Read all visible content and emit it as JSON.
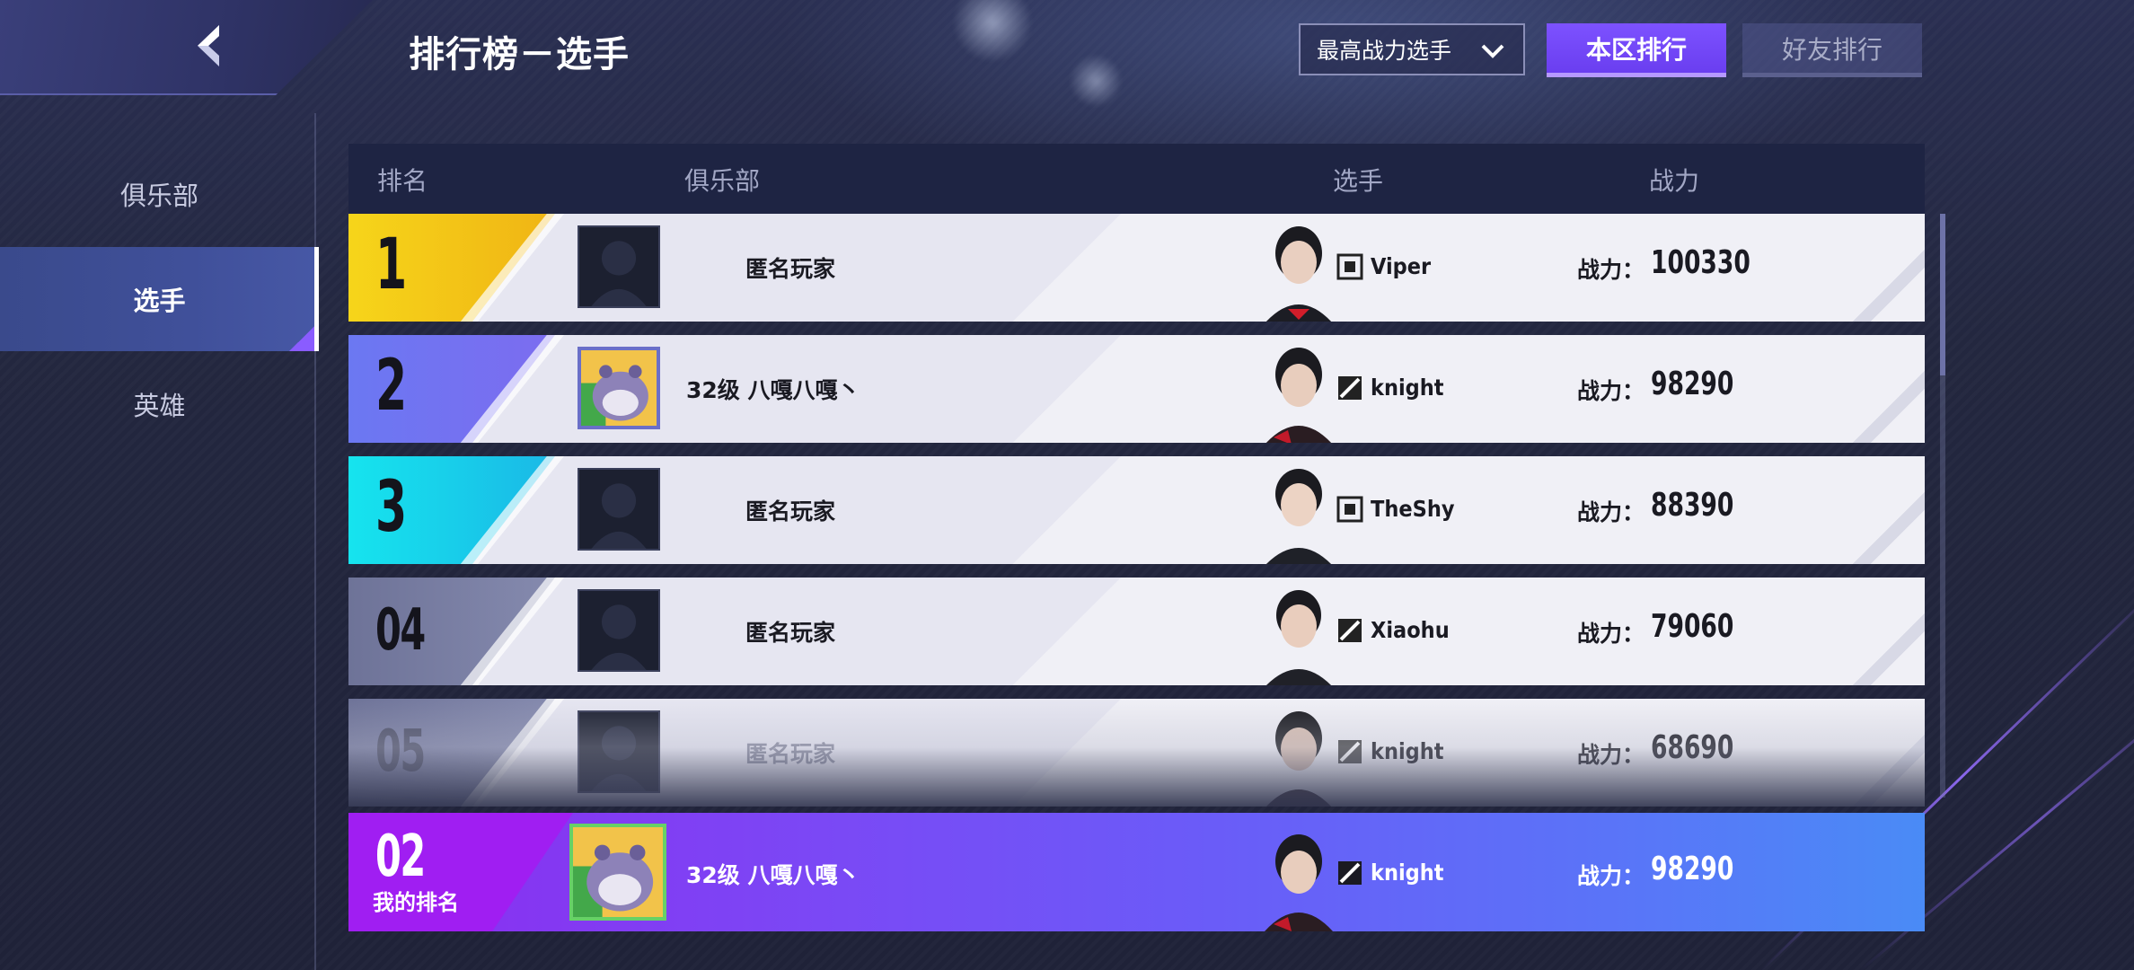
{
  "header": {
    "title": "排行榜－选手",
    "dropdown_label": "最高战力选手",
    "tab_local": "本区排行",
    "tab_friends": "好友排行"
  },
  "sidebar": {
    "items": [
      {
        "label": "俱乐部"
      },
      {
        "label": "选手"
      },
      {
        "label": "英雄"
      }
    ]
  },
  "table": {
    "headers": {
      "rank": "排名",
      "club": "俱乐部",
      "player": "选手",
      "power": "战力"
    },
    "rows": [
      {
        "rank": "1",
        "club": "匿名玩家",
        "player": "Viper",
        "power_label": "战力：",
        "power": "100330",
        "rank_color": "#f6c81a"
      },
      {
        "rank": "2",
        "club": "32级  八嘎八嘎丶",
        "player": "knight",
        "power_label": "战力：",
        "power": "98290",
        "rank_color": "#6f7ef2"
      },
      {
        "rank": "3",
        "club": "匿名玩家",
        "player": "TheShy",
        "power_label": "战力：",
        "power": "88390",
        "rank_color": "#19d6e8"
      },
      {
        "rank": "04",
        "club": "匿名玩家",
        "player": "Xiaohu",
        "power_label": "战力：",
        "power": "79060",
        "rank_color": "#7a7fa6"
      },
      {
        "rank": "05",
        "club": "匿名玩家",
        "player": "knight",
        "power_label": "战力：",
        "power": "68690",
        "rank_color": "#7a7fa6"
      }
    ]
  },
  "my_rank": {
    "rank": "02",
    "label": "我的排名",
    "club": "32级  八嘎八嘎丶",
    "player": "knight",
    "power_label": "战力：",
    "power": "98290"
  },
  "colors": {
    "accent_purple": "#7d52ff",
    "gold": "#f6c81a",
    "blue": "#6f7ef2",
    "cyan": "#19d6e8"
  }
}
